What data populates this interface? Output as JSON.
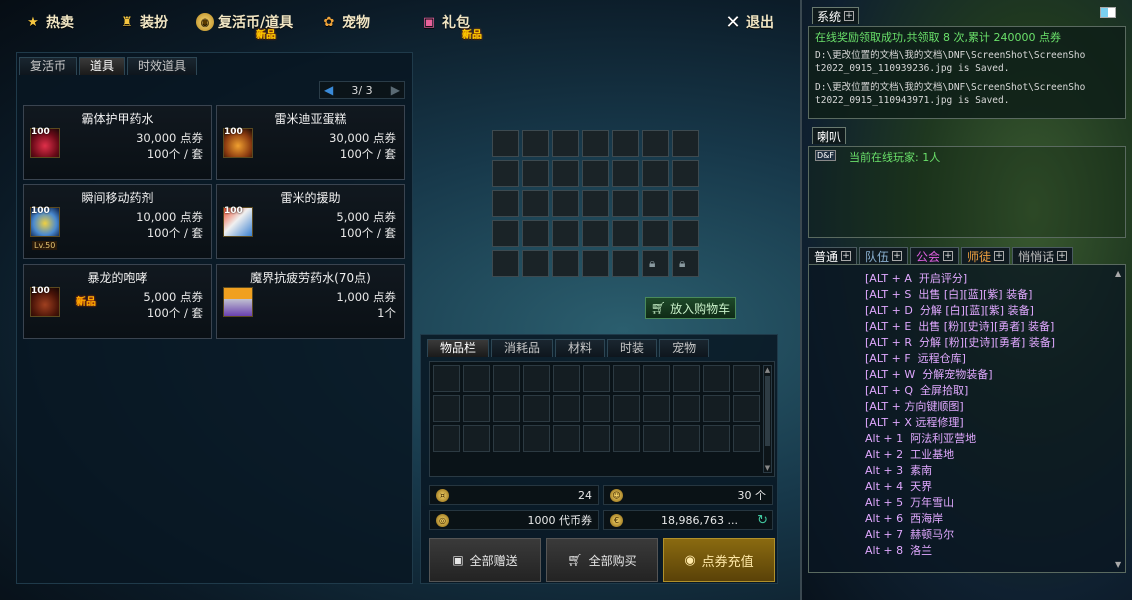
{
  "menu": [
    {
      "label": "热卖",
      "icon": "star-icon"
    },
    {
      "label": "装扮",
      "icon": "trophy-icon"
    },
    {
      "label": "复活币/道具",
      "icon": "coin-icon",
      "badge": "新品"
    },
    {
      "label": "宠物",
      "icon": "paw-icon"
    },
    {
      "label": "礼包",
      "icon": "gift-icon",
      "badge": "新品"
    },
    {
      "label": "退出",
      "icon": "close-icon"
    }
  ],
  "shop_tabs": [
    "复活币",
    "道具",
    "时效道具"
  ],
  "shop_tab_active": "道具",
  "pager": {
    "text": "3/ 3"
  },
  "items": [
    {
      "name": "霸体护甲药水",
      "quantity_badge": "100",
      "price": "30,000 点券",
      "qty": "100个 / 套"
    },
    {
      "name": "雷米迪亚蛋糕",
      "quantity_badge": "100",
      "price": "30,000 点券",
      "qty": "100个 / 套"
    },
    {
      "name": "瞬间移动药剂",
      "quantity_badge": "100",
      "price": "10,000 点券",
      "qty": "100个 / 套",
      "level": "Lv.50"
    },
    {
      "name": "雷米的援助",
      "quantity_badge": "100",
      "price": "5,000 点券",
      "qty": "100个 / 套"
    },
    {
      "name": "暴龙的咆哮",
      "quantity_badge": "100",
      "price": "5,000 点券",
      "qty": "100个 / 套",
      "badge": "新品"
    },
    {
      "name": "魔界抗疲劳药水(70点)",
      "quantity_badge": "",
      "price": "1,000 点券",
      "qty": "1个"
    }
  ],
  "cart_button": "放入购物车",
  "inventory_tabs": [
    "物品栏",
    "消耗品",
    "材料",
    "时装",
    "宠物"
  ],
  "inventory_tab_active": "物品栏",
  "currency": {
    "a": "24",
    "b": "30 个",
    "c": "1000 代币券",
    "d": "18,986,763 ..."
  },
  "buttons": {
    "gift_all": "全部赠送",
    "buy_all": "全部购买",
    "recharge": "点券充值"
  },
  "system": {
    "tab": "系统",
    "lines": [
      "在线奖励领取成功,共领取 8 次,累计 240000 点券",
      "D:\\更改位置的文档\\我的文档\\DNF\\ScreenShot\\ScreenSho",
      "t2022_0915_110939236.jpg is Saved.",
      "D:\\更改位置的文档\\我的文档\\DNF\\ScreenShot\\ScreenSho",
      "t2022_0915_110943971.jpg is Saved."
    ]
  },
  "horn": {
    "tab": "喇叭",
    "tag": "D&F",
    "line": "当前在线玩家: 1人"
  },
  "chat_tabs": [
    {
      "label": "普通",
      "color": "#ffffff"
    },
    {
      "label": "队伍",
      "color": "#8ab0d0"
    },
    {
      "label": "公会",
      "color": "#e060e0"
    },
    {
      "label": "师徒",
      "color": "#f0a040"
    },
    {
      "label": "悄悄话",
      "color": "#c0c0c0"
    }
  ],
  "chat_lines": [
    {
      "text": "[ALT + A  开启评分]",
      "color": "#e0a8ff"
    },
    {
      "text": "[ALT + S  出售 [白][蓝][紫] 装备]",
      "color": "#e0a8ff"
    },
    {
      "text": "[ALT + D  分解 [白][蓝][紫] 装备]",
      "color": "#e0a8ff"
    },
    {
      "text": "[ALT + E  出售 [粉][史诗][勇者] 装备]",
      "color": "#e0a8ff"
    },
    {
      "text": "[ALT + R  分解 [粉][史诗][勇者] 装备]",
      "color": "#e0a8ff"
    },
    {
      "text": "[ALT + F  远程仓库]",
      "color": "#e0a8ff"
    },
    {
      "text": "[ALT + W  分解宠物装备]",
      "color": "#e0a8ff"
    },
    {
      "text": "[ALT + Q  全屏拾取]",
      "color": "#e0a8ff"
    },
    {
      "text": "[ALT + 方向键顺图]",
      "color": "#e0a8ff"
    },
    {
      "text": "[ALT + X 远程修理]",
      "color": "#e0a8ff"
    },
    {
      "text": "Alt + 1  阿法利亚营地",
      "color": "#e0a8ff"
    },
    {
      "text": "Alt + 2  工业基地",
      "color": "#e0a8ff"
    },
    {
      "text": "Alt + 3  素南",
      "color": "#e0a8ff"
    },
    {
      "text": "Alt + 4  天界",
      "color": "#e0a8ff"
    },
    {
      "text": "Alt + 5  万年雪山",
      "color": "#e0a8ff"
    },
    {
      "text": "Alt + 6  西海岸",
      "color": "#e0a8ff"
    },
    {
      "text": "Alt + 7  赫顿马尔",
      "color": "#e0a8ff"
    },
    {
      "text": "Alt + 8  洛兰",
      "color": "#e0a8ff"
    }
  ]
}
